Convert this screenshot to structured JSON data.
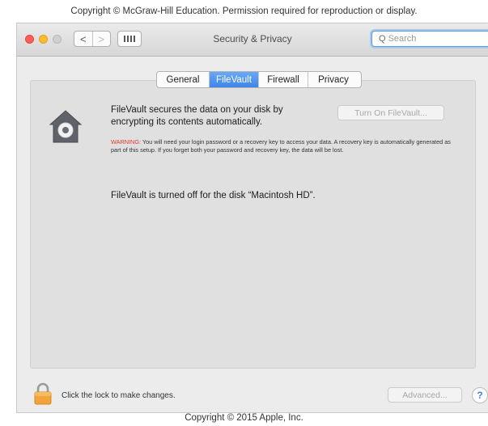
{
  "captions": {
    "top": "Copyright © McGraw-Hill Education. Permission required for reproduction or display.",
    "bottom": "Copyright © 2015 Apple, Inc."
  },
  "window": {
    "title": "Security & Privacy",
    "nav_back": "<",
    "nav_forward": ">",
    "search_placeholder": "Search"
  },
  "tabs": [
    {
      "label": "General",
      "selected": false
    },
    {
      "label": "FileVault",
      "selected": true
    },
    {
      "label": "Firewall",
      "selected": false
    },
    {
      "label": "Privacy",
      "selected": false
    }
  ],
  "filevault": {
    "description": "FileVault secures the data on your disk by encrypting its contents automatically.",
    "turn_on_button": "Turn On FileVault...",
    "warning_label": "WARNING:",
    "warning_text": " You will need your login password or a recovery key to access your data. A recovery key is automatically generated as part of this setup. If you forget both your password and recovery key, the data will be lost.",
    "status": "FileVault is turned off for the disk “Macintosh HD”."
  },
  "footer": {
    "lock_text": "Click the lock to make changes.",
    "advanced_button": "Advanced...",
    "help_button": "?"
  },
  "icons": [
    "house-safe-icon",
    "lock-icon",
    "search-icon",
    "chevron-left-icon",
    "chevron-right-icon",
    "grid-icon"
  ]
}
